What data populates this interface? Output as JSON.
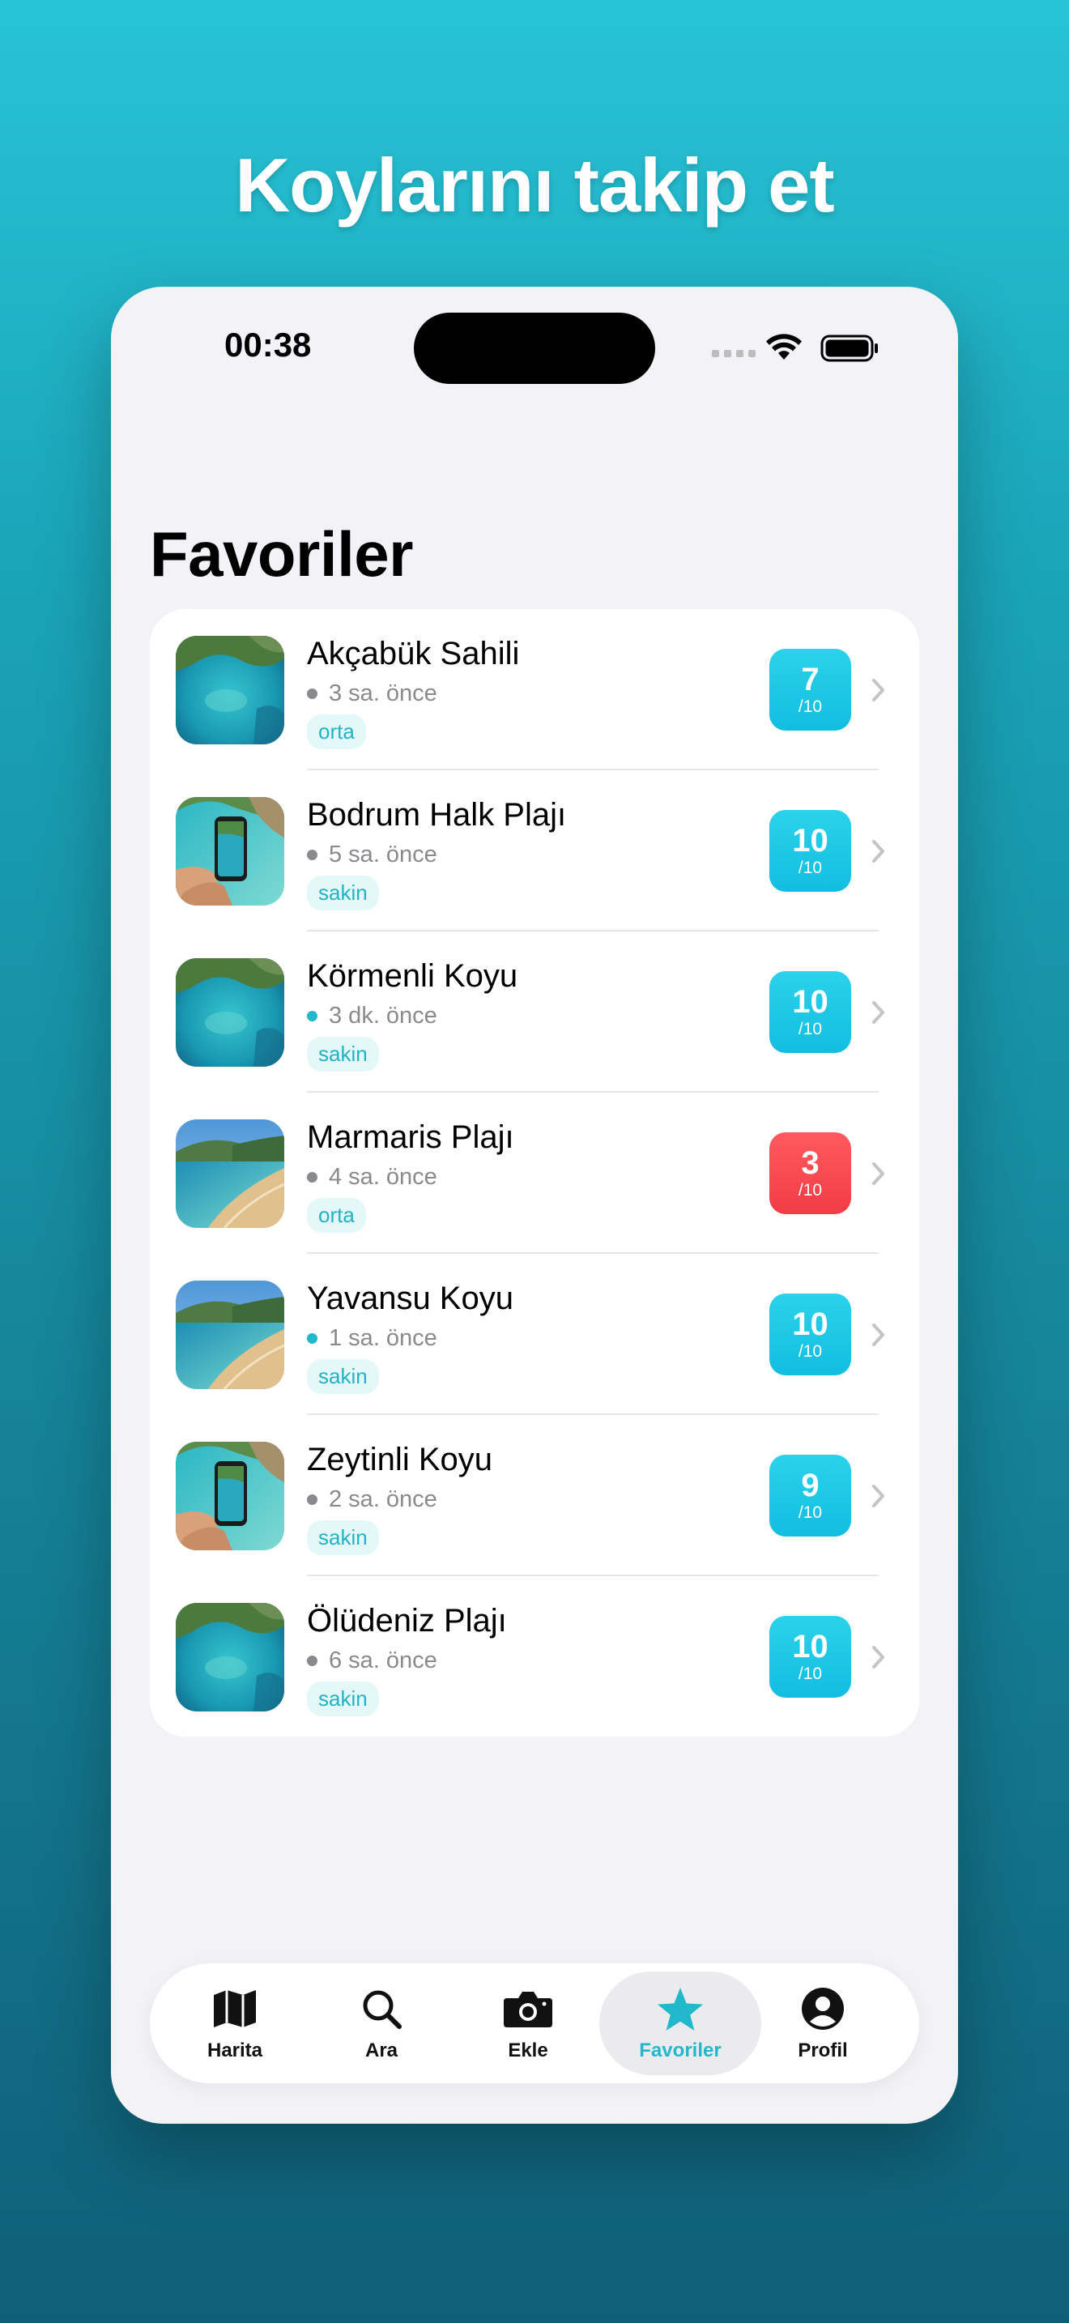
{
  "headline": "Koylarını takip et",
  "status_bar": {
    "time": "00:38"
  },
  "page_title": "Favoriler",
  "colors": {
    "accent": "#22B8CC",
    "score_good": "#18C2E3",
    "score_bad": "#F3434B",
    "dot_recent": "#22B8CC",
    "dot_old": "#8A8A8E"
  },
  "favorites": [
    {
      "name": "Akçabük Sahili",
      "ago": "3 sa. önce",
      "tag": "orta",
      "score": "7",
      "score_max": "/10",
      "recent": false,
      "image": "aerial-cove"
    },
    {
      "name": "Bodrum Halk Plajı",
      "ago": "5 sa. önce",
      "tag": "sakin",
      "score": "10",
      "score_max": "/10",
      "recent": false,
      "image": "hand-phone-beach"
    },
    {
      "name": "Körmenli Koyu",
      "ago": "3 dk. önce",
      "tag": "sakin",
      "score": "10",
      "score_max": "/10",
      "recent": true,
      "image": "aerial-cove"
    },
    {
      "name": "Marmaris Plajı",
      "ago": "4 sa. önce",
      "tag": "orta",
      "score": "3",
      "score_max": "/10",
      "recent": false,
      "image": "sandy-beach"
    },
    {
      "name": "Yavansu Koyu",
      "ago": "1 sa. önce",
      "tag": "sakin",
      "score": "10",
      "score_max": "/10",
      "recent": true,
      "image": "sandy-beach"
    },
    {
      "name": "Zeytinli Koyu",
      "ago": "2 sa. önce",
      "tag": "sakin",
      "score": "9",
      "score_max": "/10",
      "recent": false,
      "image": "hand-phone-beach"
    },
    {
      "name": "Ölüdeniz Plajı",
      "ago": "6 sa. önce",
      "tag": "sakin",
      "score": "10",
      "score_max": "/10",
      "recent": false,
      "image": "aerial-cove"
    }
  ],
  "tabbar": {
    "tabs": [
      {
        "label": "Harita",
        "icon": "map-icon",
        "active": false
      },
      {
        "label": "Ara",
        "icon": "search-icon",
        "active": false
      },
      {
        "label": "Ekle",
        "icon": "camera-icon",
        "active": false
      },
      {
        "label": "Favoriler",
        "icon": "star-icon",
        "active": true
      },
      {
        "label": "Profil",
        "icon": "profile-icon",
        "active": false
      }
    ]
  }
}
